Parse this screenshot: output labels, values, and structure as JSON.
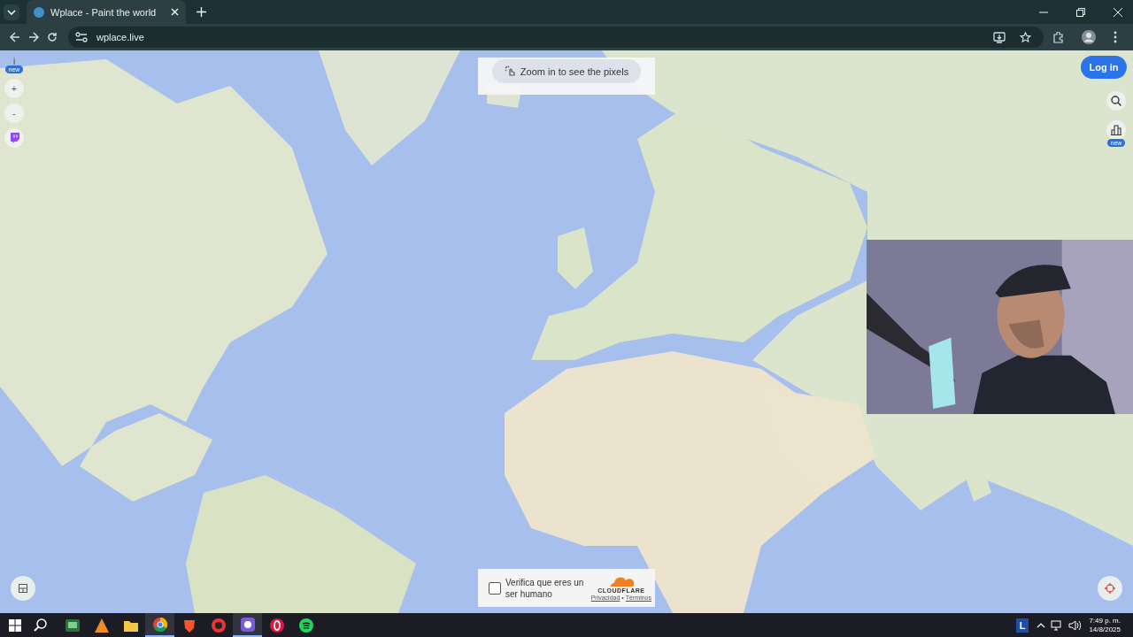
{
  "browser": {
    "tabs": [
      {
        "title": "Wplace - Paint the world",
        "selected": true
      }
    ],
    "address": "wplace.live"
  },
  "left_controls": {
    "info": "i",
    "info_badge": "new",
    "zoom_in": "+",
    "zoom_out": "-"
  },
  "banner": {
    "text": "Zoom in to see the pixels"
  },
  "login": {
    "label": "Log in"
  },
  "right_controls": {
    "stats_badge": "new"
  },
  "captcha": {
    "checked": false,
    "label": "Verifica que eres un ser humano",
    "brand": "CLOUDFLARE",
    "links": [
      "Privacidad",
      "Términos"
    ],
    "separator": "•"
  },
  "taskbar": {
    "language": "L",
    "time": "7:49 p. m.",
    "date": "14/8/2025"
  }
}
